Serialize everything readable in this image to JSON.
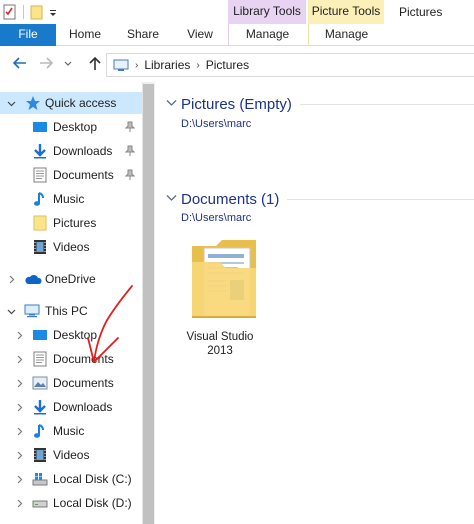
{
  "window": {
    "title": "Pictures",
    "context_tabs": {
      "library_tools": "Library Tools",
      "picture_tools": "Picture Tools"
    }
  },
  "ribbon": {
    "tabs": [
      "File",
      "Home",
      "Share",
      "View",
      "Manage",
      "Manage"
    ]
  },
  "address": {
    "crumbs": [
      "Libraries",
      "Pictures"
    ]
  },
  "nav": {
    "quick_access": {
      "label": "Quick access",
      "items": [
        {
          "label": "Desktop",
          "icon": "desktop-icon",
          "pinned": true
        },
        {
          "label": "Downloads",
          "icon": "downloads-icon",
          "pinned": true
        },
        {
          "label": "Documents",
          "icon": "documents-icon",
          "pinned": true
        },
        {
          "label": "Music",
          "icon": "music-icon",
          "pinned": false
        },
        {
          "label": "Pictures",
          "icon": "folder-icon",
          "pinned": false
        },
        {
          "label": "Videos",
          "icon": "videos-icon",
          "pinned": false
        }
      ]
    },
    "onedrive": {
      "label": "OneDrive"
    },
    "this_pc": {
      "label": "This PC",
      "items": [
        {
          "label": "Desktop",
          "icon": "desktop-icon"
        },
        {
          "label": "Documents",
          "icon": "documents-icon"
        },
        {
          "label": "Documents",
          "icon": "pictures-icon"
        },
        {
          "label": "Downloads",
          "icon": "downloads-icon"
        },
        {
          "label": "Music",
          "icon": "music-icon"
        },
        {
          "label": "Videos",
          "icon": "videos-icon"
        },
        {
          "label": "Local Disk (C:)",
          "icon": "windows-drive-icon"
        },
        {
          "label": "Local Disk (D:)",
          "icon": "drive-icon"
        }
      ]
    }
  },
  "content": {
    "groups": [
      {
        "title": "Pictures (Empty)",
        "path": "D:\\Users\\marc"
      },
      {
        "title": "Documents (1)",
        "path": "D:\\Users\\marc"
      }
    ],
    "items": [
      {
        "label_line1": "Visual Studio",
        "label_line2": "2013",
        "icon": "folder-icon"
      }
    ]
  },
  "colors": {
    "file_tab": "#1979ca",
    "library_tools": "#e8d4f2",
    "picture_tools": "#fbf1b8",
    "selection": "#cce8ff",
    "group_title": "#1e3287",
    "annotation": "#e0201f"
  }
}
